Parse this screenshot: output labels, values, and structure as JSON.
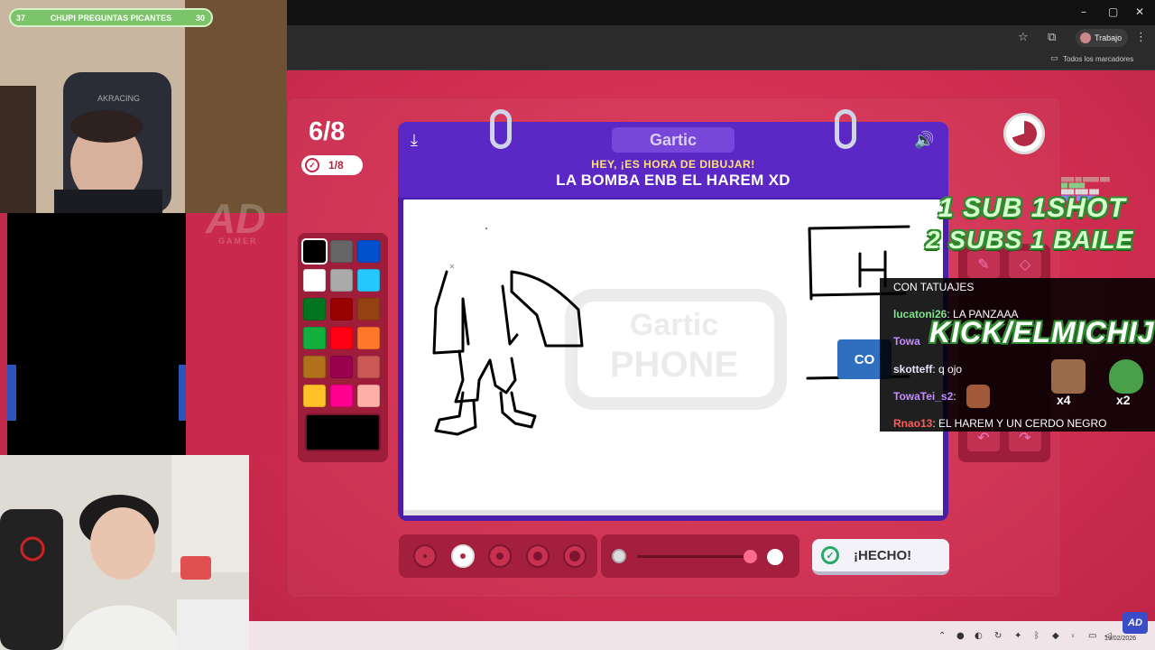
{
  "browser": {
    "window_controls": [
      "–",
      "▢",
      "✕"
    ],
    "profile_label": "Trabajo",
    "bookmarks_label": "Todos los marcadores"
  },
  "stream": {
    "poll": {
      "left_count": "37",
      "title": "CHUPI PREGUNTAS PICANTES",
      "right_count": "30"
    },
    "watermark": "AD",
    "watermark_sub": "GAMER",
    "overlay_line1": "1 SUB  1SHOT",
    "overlay_line2": "2 SUBS 1 BAILE",
    "kick_handle": "KICK/ELMICHIJ",
    "chat": [
      {
        "user": "",
        "text": "CON TATUAJES",
        "color": "white"
      },
      {
        "user": "lucatoni26",
        "text": "LA PANZAAA",
        "color": "green"
      },
      {
        "user": "Towa",
        "text": "",
        "color": "purple"
      },
      {
        "user": "skotteff",
        "text": "q ojo",
        "color": "white"
      },
      {
        "user": "TowaTei_s2",
        "text": "",
        "color": "purple"
      },
      {
        "user": "Rnao13",
        "text": "EL HAREM Y UN CERDO NEGRO",
        "color": "red"
      }
    ],
    "emote_mults": [
      "x4",
      "x2"
    ],
    "taskbar_date": "19/02/2026",
    "ad_logo": "AD"
  },
  "game": {
    "round": "6/8",
    "submitted": "1/8",
    "logo": "Gartic",
    "instruction_top": "HEY, ¡ES HORA DE DIBUJAR!",
    "instruction_main": "LA BOMBA ENB EL HAREM XD",
    "done_label": "¡HECHO!",
    "watermark_line1": "Gartic",
    "watermark_line2": "PHONE",
    "timer_remaining_fraction": 0.3,
    "palette": [
      "#000000",
      "#666666",
      "#0050cd",
      "#ffffff",
      "#aaaaaa",
      "#26c9ff",
      "#017420",
      "#990000",
      "#964112",
      "#11b03c",
      "#ff0013",
      "#ff7829",
      "#b0701c",
      "#99004e",
      "#cb5a57",
      "#ffc126",
      "#ff008f",
      "#feafa8"
    ],
    "selected_color": "#000000",
    "brush_sizes": [
      1,
      2,
      3,
      4,
      5
    ],
    "selected_brush_index": 1,
    "opacity_level": 1.0,
    "right_tool_partial_text": "CO"
  }
}
